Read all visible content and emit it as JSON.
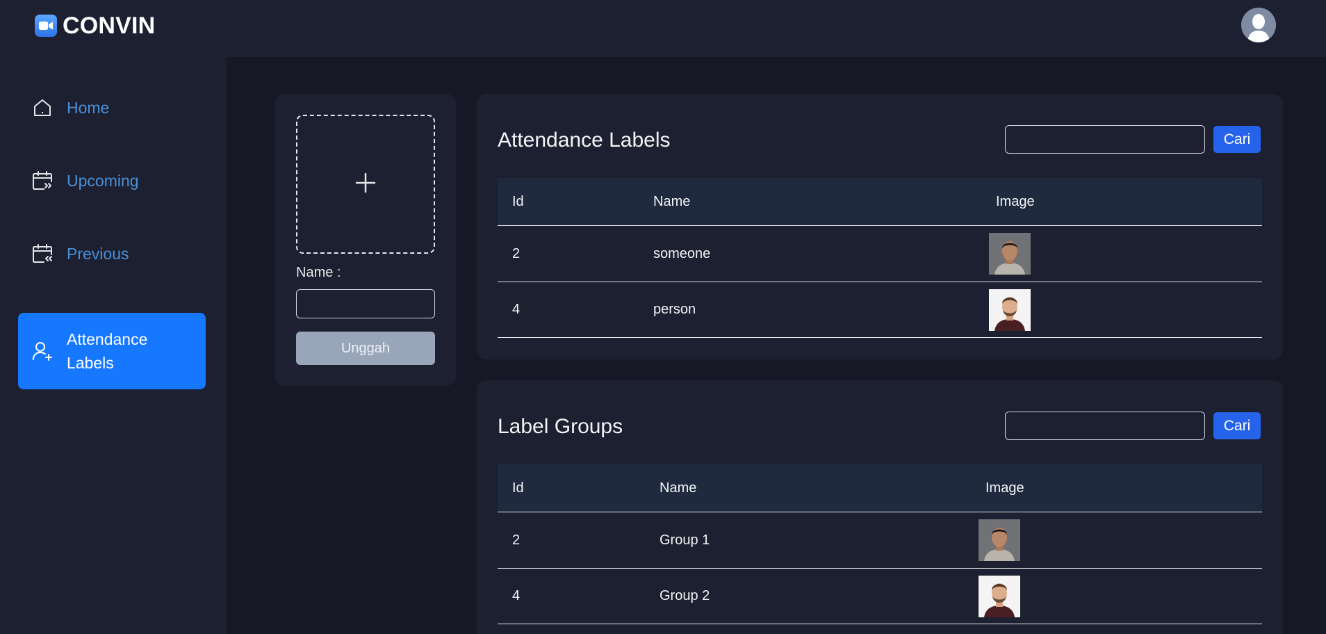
{
  "app": {
    "name": "CONVIN"
  },
  "sidebar": {
    "items": [
      {
        "label": "Home",
        "icon": "home-icon"
      },
      {
        "label": "Upcoming",
        "icon": "calendar-forward-icon"
      },
      {
        "label": "Previous",
        "icon": "calendar-back-icon"
      },
      {
        "label": "Attendance Labels",
        "icon": "user-plus-icon",
        "active": true
      }
    ]
  },
  "upload": {
    "name_label": "Name :",
    "name_value": "",
    "button_label": "Unggah"
  },
  "attendance": {
    "title": "Attendance Labels",
    "search_value": "",
    "search_button": "Cari",
    "columns": [
      "Id",
      "Name",
      "Image"
    ],
    "rows": [
      {
        "id": "2",
        "name": "someone",
        "image": "portrait-grey-background"
      },
      {
        "id": "4",
        "name": "person",
        "image": "portrait-white-background"
      }
    ]
  },
  "groups": {
    "title": "Label Groups",
    "search_value": "",
    "search_button": "Cari",
    "columns": [
      "Id",
      "Name",
      "Image"
    ],
    "rows": [
      {
        "id": "2",
        "name": "Group 1",
        "image": "portrait-grey-background"
      },
      {
        "id": "4",
        "name": "Group 2",
        "image": "portrait-white-background"
      }
    ]
  },
  "colors": {
    "accent": "#1677ff",
    "nav_text": "#4a90d9",
    "search_button": "#2563eb",
    "upload_button": "#99a6ba",
    "background": "#161925",
    "panel": "#1d2030"
  }
}
